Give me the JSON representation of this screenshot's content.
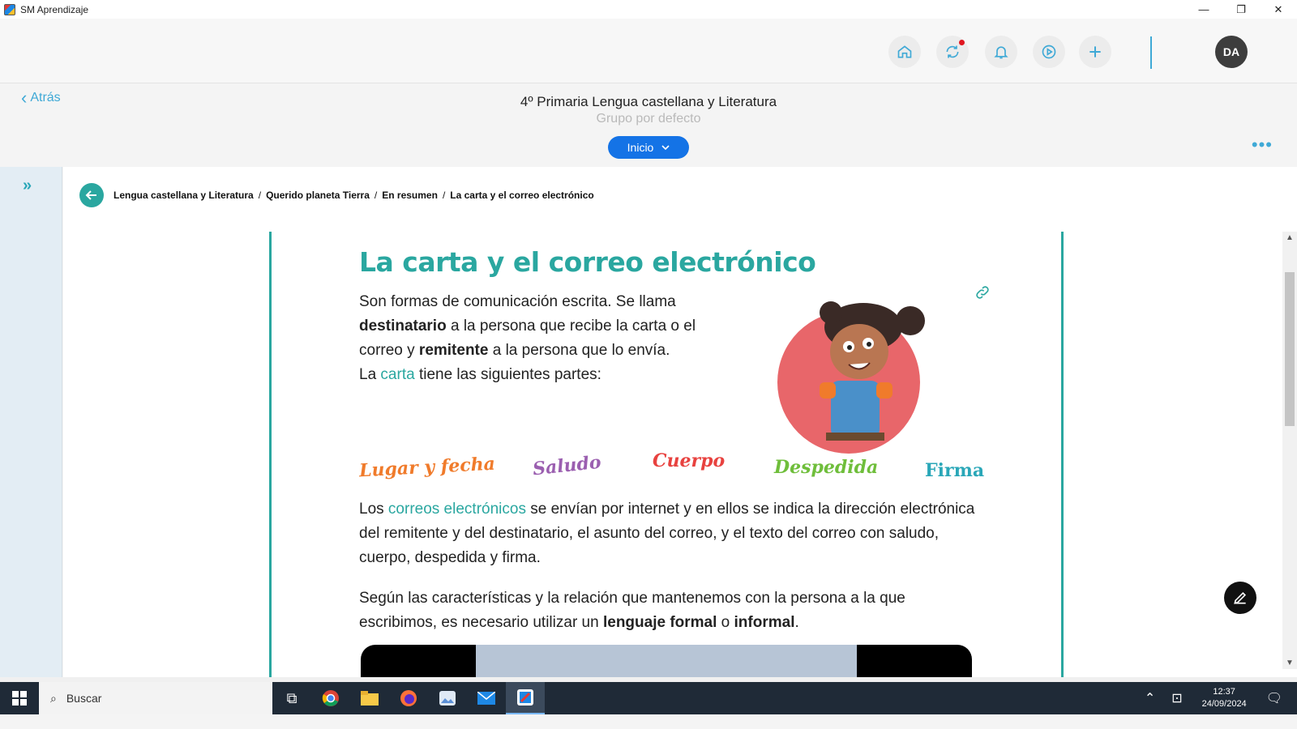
{
  "window": {
    "title": "SM Aprendizaje",
    "controls": {
      "minimize": "—",
      "maximize": "❐",
      "close": "✕"
    }
  },
  "header": {
    "icons": [
      "home-icon",
      "sync-icon",
      "bell-icon",
      "play-icon",
      "plus-icon"
    ],
    "avatar_initials": "DA"
  },
  "subheader": {
    "back_label": "Atrás",
    "course_title": "4º Primaria Lengua castellana y Literatura",
    "group": "Grupo por defecto",
    "section_button": "Inicio",
    "more": "•••"
  },
  "breadcrumb": [
    "Lengua castellana y Literatura",
    "Querido planeta Tierra",
    "En resumen",
    "La carta y el correo electrónico"
  ],
  "lesson": {
    "title": "La carta y el correo electrónico",
    "intro": {
      "t1": "Son formas de comunicación escrita. Se llama ",
      "b1": "destinatario",
      "t2": " a la persona que recibe la carta o el correo y ",
      "b2": "remitente",
      "t3": " a la persona que lo envía.",
      "t4": "La ",
      "h1": "carta",
      "t5": " tiene las siguientes partes:"
    },
    "parts": [
      {
        "label": "Lugar y fecha",
        "color": "#f07b2b"
      },
      {
        "label": "Saludo",
        "color": "#9b5fb0"
      },
      {
        "label": "Cuerpo",
        "color": "#e8423f"
      },
      {
        "label": "Despedida",
        "color": "#6fbe3b"
      },
      {
        "label": "Firma",
        "color": "#2aa7b8"
      }
    ],
    "para2": {
      "t1": "Los ",
      "h1": "correos electrónicos",
      "t2": " se envían por internet y en ellos se indica la dirección electrónica del remitente y del destinatario, el asunto del correo, y el texto del correo con saludo, cuerpo, despedida y firma."
    },
    "para3": {
      "t1": "Según las características y la relación que mantenemos con la persona a la que escribimos, es necesario utilizar un ",
      "b1": "lenguaje formal",
      "t2": " o ",
      "b2": "informal",
      "t3": "."
    }
  },
  "taskbar": {
    "search_placeholder": "Buscar",
    "time": "12:37",
    "date": "24/09/2024"
  },
  "colors": {
    "accent_teal": "#2aa7a0",
    "accent_blue": "#1473e6",
    "icon_blue": "#3fa9d6"
  }
}
